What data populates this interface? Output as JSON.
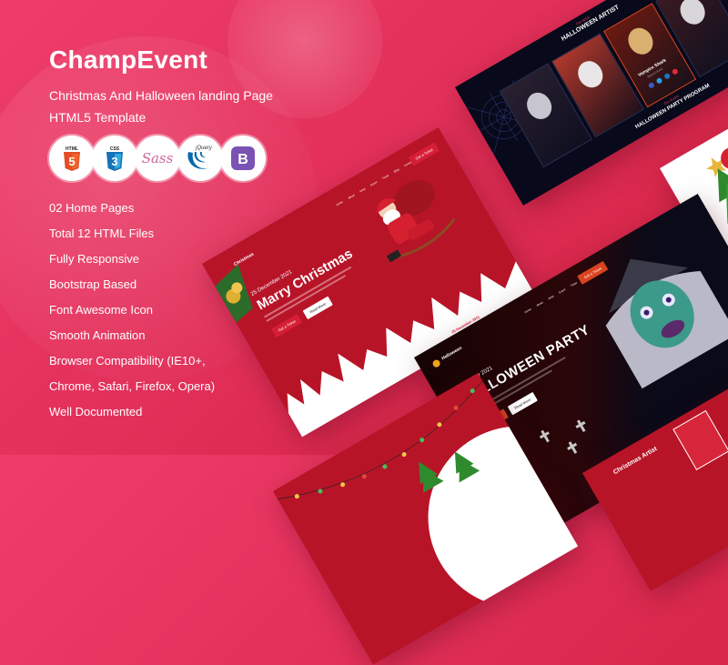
{
  "product": {
    "title": "ChampEvent",
    "subtitle_line1": "Christmas And Halloween landing Page",
    "subtitle_line2": "HTML5 Template"
  },
  "tech_badges": [
    {
      "name": "html5-icon",
      "label": "HTML",
      "glyph": "5",
      "color": "#e44d26"
    },
    {
      "name": "css3-icon",
      "label": "CSS",
      "glyph": "3",
      "color": "#1572b6"
    },
    {
      "name": "sass-icon",
      "label": "Sass",
      "color": "#cd6799"
    },
    {
      "name": "jquery-icon",
      "label": "jQuery",
      "color": "#0769ad"
    },
    {
      "name": "bootstrap-icon",
      "label": "B",
      "color": "#7952b3"
    }
  ],
  "features": [
    "02 Home Pages",
    "Total 12 HTML Files",
    "Fully Responsive",
    "Bootstrap Based",
    "Font Awesome Icon",
    "Smooth Animation",
    "Browser Compatibility (IE10+,",
    "Chrome, Safari, Firefox, Opera)",
    "Well Documented"
  ],
  "christmas_preview": {
    "logo": "Christmas",
    "nav": [
      "Home",
      "About",
      "Artist",
      "Event",
      "Ticket",
      "Blog",
      "Contact"
    ],
    "cta": "Get a Ticket",
    "date": "25 December 2021",
    "headline": "Marry Christmas",
    "primary_button": "Get a Ticket",
    "secondary_button": "Read More",
    "section_date": "25 December 2021"
  },
  "halloween_artist_preview": {
    "eyebrow": "Our Artist",
    "heading": "HALLOWEEN ARTIST",
    "featured_artist": "Vampire Shark",
    "featured_role": "Special Guest",
    "program_eyebrow": "Our Event",
    "program_heading": "HALLOWEEN PARTY PROGRAM"
  },
  "halloween_preview": {
    "logo": "Halloween",
    "nav": [
      "Home",
      "About",
      "Artist",
      "Event",
      "Ticket",
      "Blog",
      "Contact"
    ],
    "cta": "Get a Ticket",
    "date": "31 October 2021",
    "headline": "HALLOWEEN PARTY",
    "primary_button": "Get a Ticket",
    "secondary_button": "Read More"
  },
  "christmas_artist_preview": {
    "heading": "Christmas Artist"
  },
  "colors": {
    "background": "#e2305a",
    "christmas_red": "#b81428",
    "halloween_dark": "#08091a",
    "halloween_accent": "#d9431e"
  }
}
